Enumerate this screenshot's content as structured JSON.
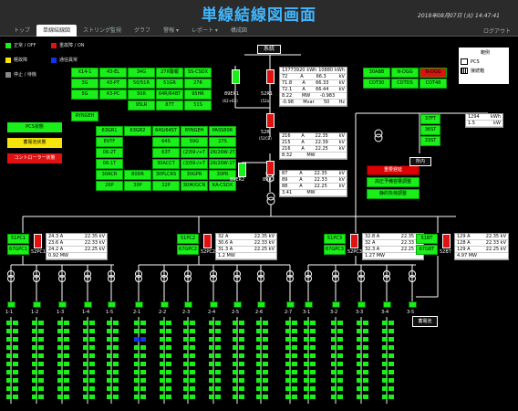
{
  "app": {
    "title": "単線結線図画面",
    "datetime": "2018年08月07日 (火) 14:47:41",
    "logout": "ログアウト"
  },
  "tabs": [
    {
      "label": "トップ"
    },
    {
      "label": "単線結線図"
    },
    {
      "label": "ストリング監視"
    },
    {
      "label": "グラフ"
    },
    {
      "label": "警報 ▾"
    },
    {
      "label": "レポート ▾"
    },
    {
      "label": "構成図"
    }
  ],
  "legend": [
    {
      "label": "正常 / OFF",
      "color": "#1aef1a"
    },
    {
      "label": "重故障 / ON",
      "color": "#e01111"
    },
    {
      "label": "軽故障",
      "color": "#f5e40b"
    },
    {
      "label": "通信異常",
      "color": "#1133ee"
    },
    {
      "label": "停止 / 待機",
      "color": "#888888"
    }
  ],
  "status_buttons": [
    {
      "label": "PCS状態",
      "color": "#1aef1a",
      "text": "#000"
    },
    {
      "label": "蓄電池状態",
      "color": "#f5e40b",
      "text": "#000"
    },
    {
      "label": "コントローラー状態",
      "color": "#e01111",
      "text": "#fff"
    }
  ],
  "grid_label": "系統",
  "grid_panel_a": [
    "X14-1",
    "43-EL",
    "34G",
    "27R警報",
    "SS-CSDX",
    "3G",
    "43-PT",
    "50/51R",
    "51GR",
    "27R",
    "5G",
    "43-PC",
    "50R",
    "64R/64BT",
    "95HR",
    "",
    "",
    "95LR",
    "87T",
    "51S",
    "RYNGEH"
  ],
  "grid_panel_b": [
    "63GR1",
    "63GR2",
    "64S/64ST",
    "RYNGEH",
    "PASS80R",
    "EVTF",
    "",
    "64S",
    "59G",
    "27S",
    "06-2T",
    "",
    "63T",
    "(2)59-/+T",
    "26/26W-2T",
    "06-1T",
    "",
    "30ACCT",
    "(3)59-/+T",
    "26/26W-1T",
    "30ACR",
    "80DR",
    "30PLCRS",
    "30GPR",
    "30PR",
    "26P",
    "30P",
    "32P",
    "30Ж/GCN",
    "KA-CSDX"
  ],
  "main_readings": [
    {
      "v": "13773920",
      "u": "kWh"
    },
    {
      "v": "10880",
      "u": "kWh"
    },
    {
      "v": "72",
      "u": "A"
    },
    {
      "v": "66.3",
      "u": "kV"
    },
    {
      "v": "71.8",
      "u": "A"
    },
    {
      "v": "66.33",
      "u": "kV"
    },
    {
      "v": "72.1",
      "u": "A"
    },
    {
      "v": "66.44",
      "u": "kV"
    },
    {
      "v": "8.22",
      "u": "MW"
    },
    {
      "v": "-0.983",
      "u": ""
    },
    {
      "v": "-0.98",
      "u": "Mvar"
    },
    {
      "v": "50",
      "u": "Hz"
    }
  ],
  "r52_readings": [
    {
      "v": "216",
      "u": "A",
      "v2": "22.35",
      "u2": "kV"
    },
    {
      "v": "215",
      "u": "A",
      "v2": "22.39",
      "u2": "kV"
    },
    {
      "v": "216",
      "u": "A",
      "v2": "22.25",
      "u2": "kV"
    },
    {
      "v": "8.32",
      "u": "MW",
      "v2": "",
      "u2": ""
    }
  ],
  "r89_readings": [
    {
      "v": "87",
      "u": "A",
      "v2": "22.35",
      "u2": "kV"
    },
    {
      "v": "89",
      "u": "A",
      "v2": "22.33",
      "u2": "kV"
    },
    {
      "v": "88",
      "u": "A",
      "v2": "22.25",
      "u2": "kV"
    },
    {
      "v": "3.41",
      "u": "MW",
      "v2": "",
      "u2": ""
    }
  ],
  "switch_labels": {
    "s89er1": "89ER1",
    "s52r1": "52R1",
    "s89er1_sub": "(62+63)",
    "s52r1_sub": "(52a)",
    "s52r": "52R",
    "s52r_sub": "(52CB)",
    "s89er2": "89ER2",
    "s89r2": "89R2"
  },
  "right_panel": [
    "30ABB",
    "N-DGG",
    "N-DGG",
    "CDT30",
    "CDTDS",
    "CDT48"
  ],
  "right_panel_colors": [
    "#1aef1a",
    "#1aef1a",
    "#e01111",
    "#1aef1a",
    "#1aef1a",
    "#1aef1a"
  ],
  "mid_buttons": [
    "重要遅延",
    "高圧予備容量調整",
    "静的負荷調整"
  ],
  "aux_panel": [
    "37FT",
    "36ST",
    "33ST"
  ],
  "aux_readings": [
    {
      "v": "1294",
      "u": "kWh"
    },
    {
      "v": "1.5",
      "u": "kW"
    }
  ],
  "aux_label": "所内",
  "legend_box": {
    "title": "範例",
    "pcs": "PCS",
    "jb": "接続箱"
  },
  "feeders": [
    {
      "g": [
        "51PC1",
        "67GPC1"
      ],
      "sw": "52PC1",
      "r": [
        [
          "24.3 A",
          "22.35 kV"
        ],
        [
          "23.6 A",
          "22.33 kV"
        ],
        [
          "24.2 A",
          "22.25 kV"
        ],
        [
          "0.92 MW",
          ""
        ]
      ]
    },
    {
      "g": [
        "51PC2",
        "67GPC2"
      ],
      "sw": "52PC2",
      "r": [
        [
          "32 A",
          "22.35 kV"
        ],
        [
          "30.6 A",
          "22.33 kV"
        ],
        [
          "31.3 A",
          "22.25 kV"
        ],
        [
          "1.2 MW",
          ""
        ]
      ]
    },
    {
      "g": [
        "51PC3",
        "67GPC3"
      ],
      "sw": "52PC3",
      "r": [
        [
          "32.8 A",
          "22.35 kV"
        ],
        [
          "32 A",
          "22.33 kV"
        ],
        [
          "32.3 A",
          "22.25 kV"
        ],
        [
          "1.27 MW",
          ""
        ]
      ]
    },
    {
      "g": [
        "51BT",
        "67GBT"
      ],
      "sw": "52BT",
      "r": [
        [
          "129 A",
          "22.35 kV"
        ],
        [
          "128 A",
          "22.33 kV"
        ],
        [
          "129 A",
          "22.25 kV"
        ],
        [
          "4.97 MW",
          ""
        ]
      ]
    }
  ],
  "pcs_labels": [
    "1-1",
    "1-2",
    "1-3",
    "1-4",
    "1-5",
    "2-1",
    "2-2",
    "2-3",
    "2-4",
    "2-5",
    "2-6",
    "2-7",
    "3-1",
    "3-2",
    "3-3",
    "3-4",
    "3-5"
  ],
  "battery_label": "蓄電池"
}
